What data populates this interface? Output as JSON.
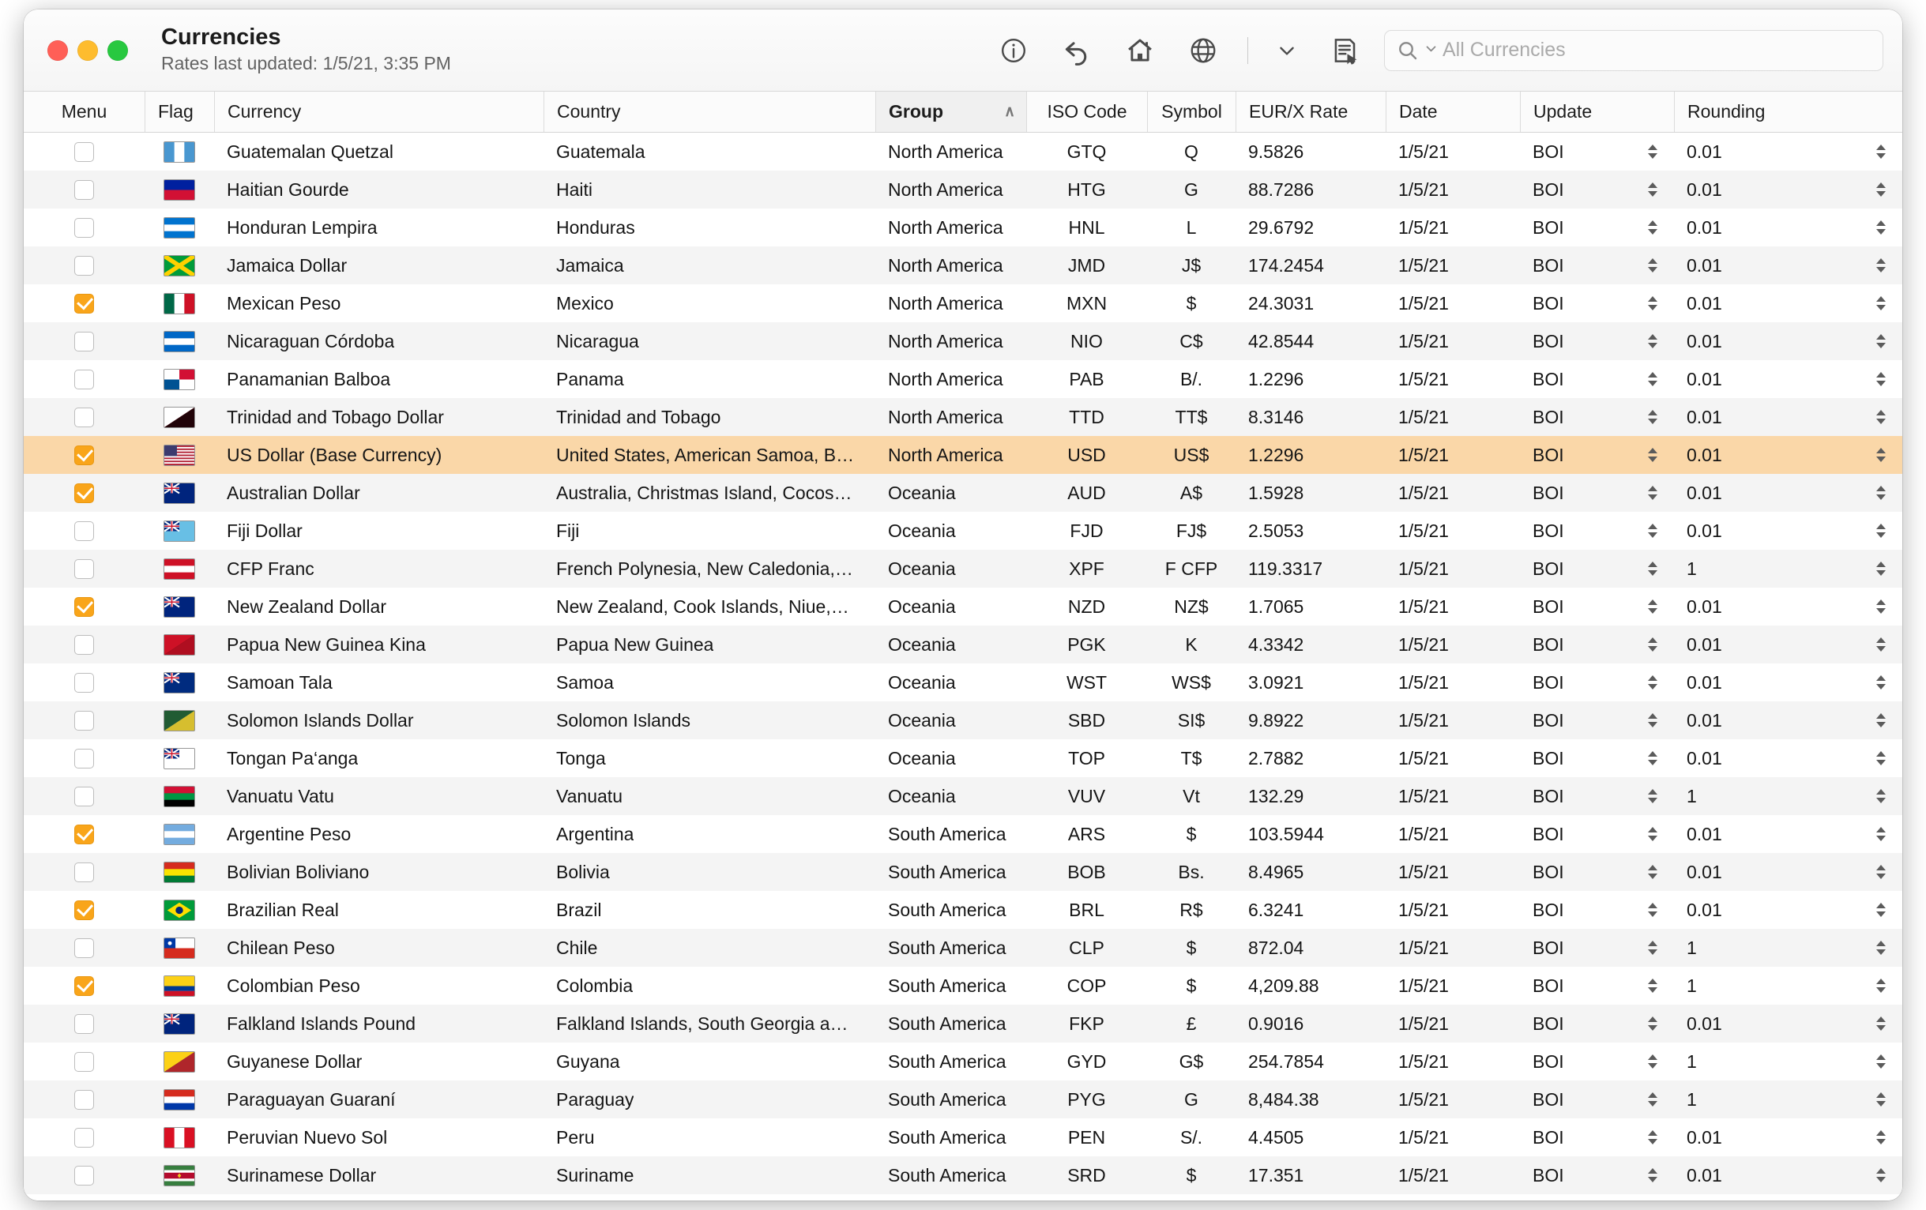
{
  "window": {
    "title": "Currencies",
    "subtitle": "Rates last updated: 1/5/21, 3:35 PM"
  },
  "toolbar": {
    "info_label": "info-icon",
    "undo_label": "undo-icon",
    "home_label": "home-icon",
    "globe_label": "globe-icon",
    "chevron_label": "chevron-down-icon",
    "note_label": "note-icon"
  },
  "search": {
    "placeholder": "All Currencies",
    "value": ""
  },
  "columns": {
    "menu": "Menu",
    "flag": "Flag",
    "currency": "Currency",
    "country": "Country",
    "group": "Group",
    "iso": "ISO Code",
    "symbol": "Symbol",
    "rate": "EUR/X Rate",
    "date": "Date",
    "update": "Update",
    "rounding": "Rounding",
    "sort_caret": "∧"
  },
  "colors": {
    "accent_checkbox": "#f9a51a",
    "selection_row": "#fad7a8",
    "alt_row": "#f4f4f4",
    "header_sorted": "#f0f0f0"
  },
  "rows": [
    {
      "checked": false,
      "currency": "Guatemalan Quetzal",
      "country": "Guatemala",
      "group": "North America",
      "iso": "GTQ",
      "symbol": "Q",
      "rate": "9.5826",
      "date": "1/5/21",
      "update": "BOI",
      "rounding": "0.01",
      "flag": "gt",
      "selected": false
    },
    {
      "checked": false,
      "currency": "Haitian Gourde",
      "country": "Haiti",
      "group": "North America",
      "iso": "HTG",
      "symbol": "G",
      "rate": "88.7286",
      "date": "1/5/21",
      "update": "BOI",
      "rounding": "0.01",
      "flag": "ht",
      "selected": false
    },
    {
      "checked": false,
      "currency": "Honduran Lempira",
      "country": "Honduras",
      "group": "North America",
      "iso": "HNL",
      "symbol": "L",
      "rate": "29.6792",
      "date": "1/5/21",
      "update": "BOI",
      "rounding": "0.01",
      "flag": "hn",
      "selected": false
    },
    {
      "checked": false,
      "currency": "Jamaica Dollar",
      "country": "Jamaica",
      "group": "North America",
      "iso": "JMD",
      "symbol": "J$",
      "rate": "174.2454",
      "date": "1/5/21",
      "update": "BOI",
      "rounding": "0.01",
      "flag": "jm",
      "selected": false
    },
    {
      "checked": true,
      "currency": "Mexican Peso",
      "country": "Mexico",
      "group": "North America",
      "iso": "MXN",
      "symbol": "$",
      "rate": "24.3031",
      "date": "1/5/21",
      "update": "BOI",
      "rounding": "0.01",
      "flag": "mx",
      "selected": false
    },
    {
      "checked": false,
      "currency": "Nicaraguan Córdoba",
      "country": "Nicaragua",
      "group": "North America",
      "iso": "NIO",
      "symbol": "C$",
      "rate": "42.8544",
      "date": "1/5/21",
      "update": "BOI",
      "rounding": "0.01",
      "flag": "ni",
      "selected": false
    },
    {
      "checked": false,
      "currency": "Panamanian Balboa",
      "country": "Panama",
      "group": "North America",
      "iso": "PAB",
      "symbol": "B/.",
      "rate": "1.2296",
      "date": "1/5/21",
      "update": "BOI",
      "rounding": "0.01",
      "flag": "pa",
      "selected": false
    },
    {
      "checked": false,
      "currency": "Trinidad and Tobago Dollar",
      "country": "Trinidad and Tobago",
      "group": "North America",
      "iso": "TTD",
      "symbol": "TT$",
      "rate": "8.3146",
      "date": "1/5/21",
      "update": "BOI",
      "rounding": "0.01",
      "flag": "tt",
      "selected": false
    },
    {
      "checked": true,
      "currency": "US Dollar (Base Currency)",
      "country": "United States, American Samoa, B…",
      "group": "North America",
      "iso": "USD",
      "symbol": "US$",
      "rate": "1.2296",
      "date": "1/5/21",
      "update": "BOI",
      "rounding": "0.01",
      "flag": "us",
      "selected": true
    },
    {
      "checked": true,
      "currency": "Australian Dollar",
      "country": "Australia, Christmas Island, Cocos…",
      "group": "Oceania",
      "iso": "AUD",
      "symbol": "A$",
      "rate": "1.5928",
      "date": "1/5/21",
      "update": "BOI",
      "rounding": "0.01",
      "flag": "au",
      "selected": false
    },
    {
      "checked": false,
      "currency": "Fiji Dollar",
      "country": "Fiji",
      "group": "Oceania",
      "iso": "FJD",
      "symbol": "FJ$",
      "rate": "2.5053",
      "date": "1/5/21",
      "update": "BOI",
      "rounding": "0.01",
      "flag": "fj",
      "selected": false
    },
    {
      "checked": false,
      "currency": "CFP Franc",
      "country": "French Polynesia, New Caledonia,…",
      "group": "Oceania",
      "iso": "XPF",
      "symbol": "F CFP",
      "rate": "119.3317",
      "date": "1/5/21",
      "update": "BOI",
      "rounding": "1",
      "flag": "pf",
      "selected": false
    },
    {
      "checked": true,
      "currency": "New Zealand Dollar",
      "country": "New Zealand, Cook Islands, Niue,…",
      "group": "Oceania",
      "iso": "NZD",
      "symbol": "NZ$",
      "rate": "1.7065",
      "date": "1/5/21",
      "update": "BOI",
      "rounding": "0.01",
      "flag": "nz",
      "selected": false
    },
    {
      "checked": false,
      "currency": "Papua New Guinea Kina",
      "country": "Papua New Guinea",
      "group": "Oceania",
      "iso": "PGK",
      "symbol": "K",
      "rate": "4.3342",
      "date": "1/5/21",
      "update": "BOI",
      "rounding": "0.01",
      "flag": "pg",
      "selected": false
    },
    {
      "checked": false,
      "currency": "Samoan Tala",
      "country": "Samoa",
      "group": "Oceania",
      "iso": "WST",
      "symbol": "WS$",
      "rate": "3.0921",
      "date": "1/5/21",
      "update": "BOI",
      "rounding": "0.01",
      "flag": "ws",
      "selected": false
    },
    {
      "checked": false,
      "currency": "Solomon Islands Dollar",
      "country": "Solomon Islands",
      "group": "Oceania",
      "iso": "SBD",
      "symbol": "SI$",
      "rate": "9.8922",
      "date": "1/5/21",
      "update": "BOI",
      "rounding": "0.01",
      "flag": "sb",
      "selected": false
    },
    {
      "checked": false,
      "currency": "Tongan Pa‘anga",
      "country": "Tonga",
      "group": "Oceania",
      "iso": "TOP",
      "symbol": "T$",
      "rate": "2.7882",
      "date": "1/5/21",
      "update": "BOI",
      "rounding": "0.01",
      "flag": "to",
      "selected": false
    },
    {
      "checked": false,
      "currency": "Vanuatu Vatu",
      "country": "Vanuatu",
      "group": "Oceania",
      "iso": "VUV",
      "symbol": "Vt",
      "rate": "132.29",
      "date": "1/5/21",
      "update": "BOI",
      "rounding": "1",
      "flag": "vu",
      "selected": false
    },
    {
      "checked": true,
      "currency": "Argentine Peso",
      "country": "Argentina",
      "group": "South America",
      "iso": "ARS",
      "symbol": "$",
      "rate": "103.5944",
      "date": "1/5/21",
      "update": "BOI",
      "rounding": "0.01",
      "flag": "ar",
      "selected": false
    },
    {
      "checked": false,
      "currency": "Bolivian Boliviano",
      "country": "Bolivia",
      "group": "South America",
      "iso": "BOB",
      "symbol": "Bs.",
      "rate": "8.4965",
      "date": "1/5/21",
      "update": "BOI",
      "rounding": "0.01",
      "flag": "bo",
      "selected": false
    },
    {
      "checked": true,
      "currency": "Brazilian Real",
      "country": "Brazil",
      "group": "South America",
      "iso": "BRL",
      "symbol": "R$",
      "rate": "6.3241",
      "date": "1/5/21",
      "update": "BOI",
      "rounding": "0.01",
      "flag": "br",
      "selected": false
    },
    {
      "checked": false,
      "currency": "Chilean Peso",
      "country": "Chile",
      "group": "South America",
      "iso": "CLP",
      "symbol": "$",
      "rate": "872.04",
      "date": "1/5/21",
      "update": "BOI",
      "rounding": "1",
      "flag": "cl",
      "selected": false
    },
    {
      "checked": true,
      "currency": "Colombian Peso",
      "country": "Colombia",
      "group": "South America",
      "iso": "COP",
      "symbol": "$",
      "rate": "4,209.88",
      "date": "1/5/21",
      "update": "BOI",
      "rounding": "1",
      "flag": "co",
      "selected": false
    },
    {
      "checked": false,
      "currency": "Falkland Islands Pound",
      "country": "Falkland Islands, South Georgia a…",
      "group": "South America",
      "iso": "FKP",
      "symbol": "£",
      "rate": "0.9016",
      "date": "1/5/21",
      "update": "BOI",
      "rounding": "0.01",
      "flag": "fk",
      "selected": false
    },
    {
      "checked": false,
      "currency": "Guyanese Dollar",
      "country": "Guyana",
      "group": "South America",
      "iso": "GYD",
      "symbol": "G$",
      "rate": "254.7854",
      "date": "1/5/21",
      "update": "BOI",
      "rounding": "1",
      "flag": "gy",
      "selected": false
    },
    {
      "checked": false,
      "currency": "Paraguayan Guaraní",
      "country": "Paraguay",
      "group": "South America",
      "iso": "PYG",
      "symbol": "G",
      "rate": "8,484.38",
      "date": "1/5/21",
      "update": "BOI",
      "rounding": "1",
      "flag": "py",
      "selected": false
    },
    {
      "checked": false,
      "currency": "Peruvian Nuevo Sol",
      "country": "Peru",
      "group": "South America",
      "iso": "PEN",
      "symbol": "S/.",
      "rate": "4.4505",
      "date": "1/5/21",
      "update": "BOI",
      "rounding": "0.01",
      "flag": "pe",
      "selected": false
    },
    {
      "checked": false,
      "currency": "Surinamese Dollar",
      "country": "Suriname",
      "group": "South America",
      "iso": "SRD",
      "symbol": "$",
      "rate": "17.351",
      "date": "1/5/21",
      "update": "BOI",
      "rounding": "0.01",
      "flag": "sr",
      "selected": false
    }
  ]
}
